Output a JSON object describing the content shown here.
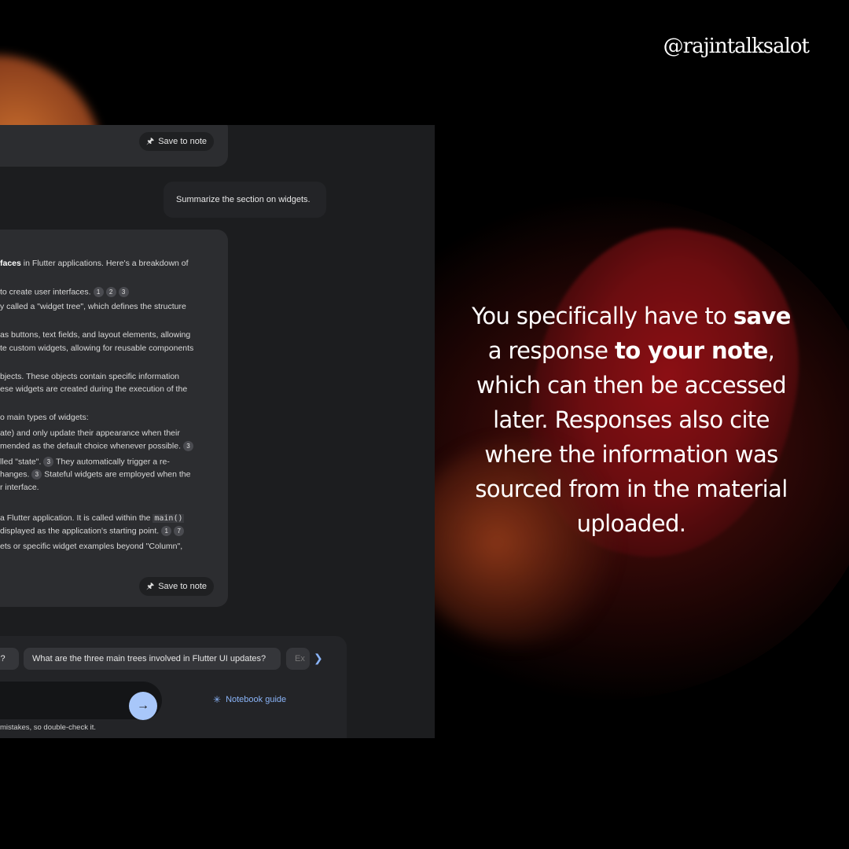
{
  "handle": "@rajintalksalot",
  "screen": {
    "save_label": "Save to note",
    "user_message": "Summarize the section on widgets.",
    "response_lines": [
      {
        "pre_bold": "faces",
        "text": " in Flutter applications. Here's a breakdown of",
        "cites": []
      },
      {
        "text": " to create user interfaces.",
        "cites": [
          "1",
          "2",
          "3"
        ]
      },
      {
        "text": "y called a \"widget tree\", which defines the structure",
        "cites": []
      },
      {
        "text": "as buttons, text fields, and layout elements, allowing",
        "cites": []
      },
      {
        "text": "te custom widgets, allowing for reusable components",
        "cites": []
      },
      {
        "text": "bjects. These objects contain specific information",
        "cites": []
      },
      {
        "text": "ese widgets are created during the execution of the",
        "cites": []
      },
      {
        "text": "o main types of widgets:",
        "cites": []
      },
      {
        "text": "ate) and only update their appearance when their",
        "cites": []
      },
      {
        "text": "mended as the default choice whenever possible.",
        "cites": [
          "3"
        ]
      },
      {
        "text": "lled \"state\".",
        "cites": [
          "3"
        ],
        "after": " They automatically trigger a re-"
      },
      {
        "text": "hanges.",
        "cites": [
          "3"
        ],
        "after": " Stateful widgets are employed when the"
      },
      {
        "text": "r interface.",
        "cites": []
      },
      {
        "text": " a Flutter application. It is called within the",
        "code": "main()",
        "cites": []
      },
      {
        "text": " displayed as the application's starting point.",
        "cites": [
          "1",
          "7"
        ]
      },
      {
        "text": "ets or specific widget examples beyond \"Column\",",
        "cites": []
      }
    ],
    "suggestions": [
      "s?",
      "What are the three main trees involved in Flutter UI updates?",
      "Ex"
    ],
    "notebook_guide": "Notebook guide",
    "disclaimer": "mistakes, so double-check it."
  },
  "caption": {
    "parts": [
      {
        "t": "You specifically have to ",
        "b": false
      },
      {
        "t": "save",
        "b": true
      },
      {
        "t": " a response ",
        "b": false
      },
      {
        "t": "to your note",
        "b": true
      },
      {
        "t": ", which can then be accessed later. Responses also cite where the information was sourced from in the material uploaded.",
        "b": false
      }
    ]
  },
  "colors": {
    "accent": "#8ab4f8",
    "send": "#a8c7fa",
    "red_blob": "#8c0f14",
    "orange_blob": "#c46a2c"
  }
}
